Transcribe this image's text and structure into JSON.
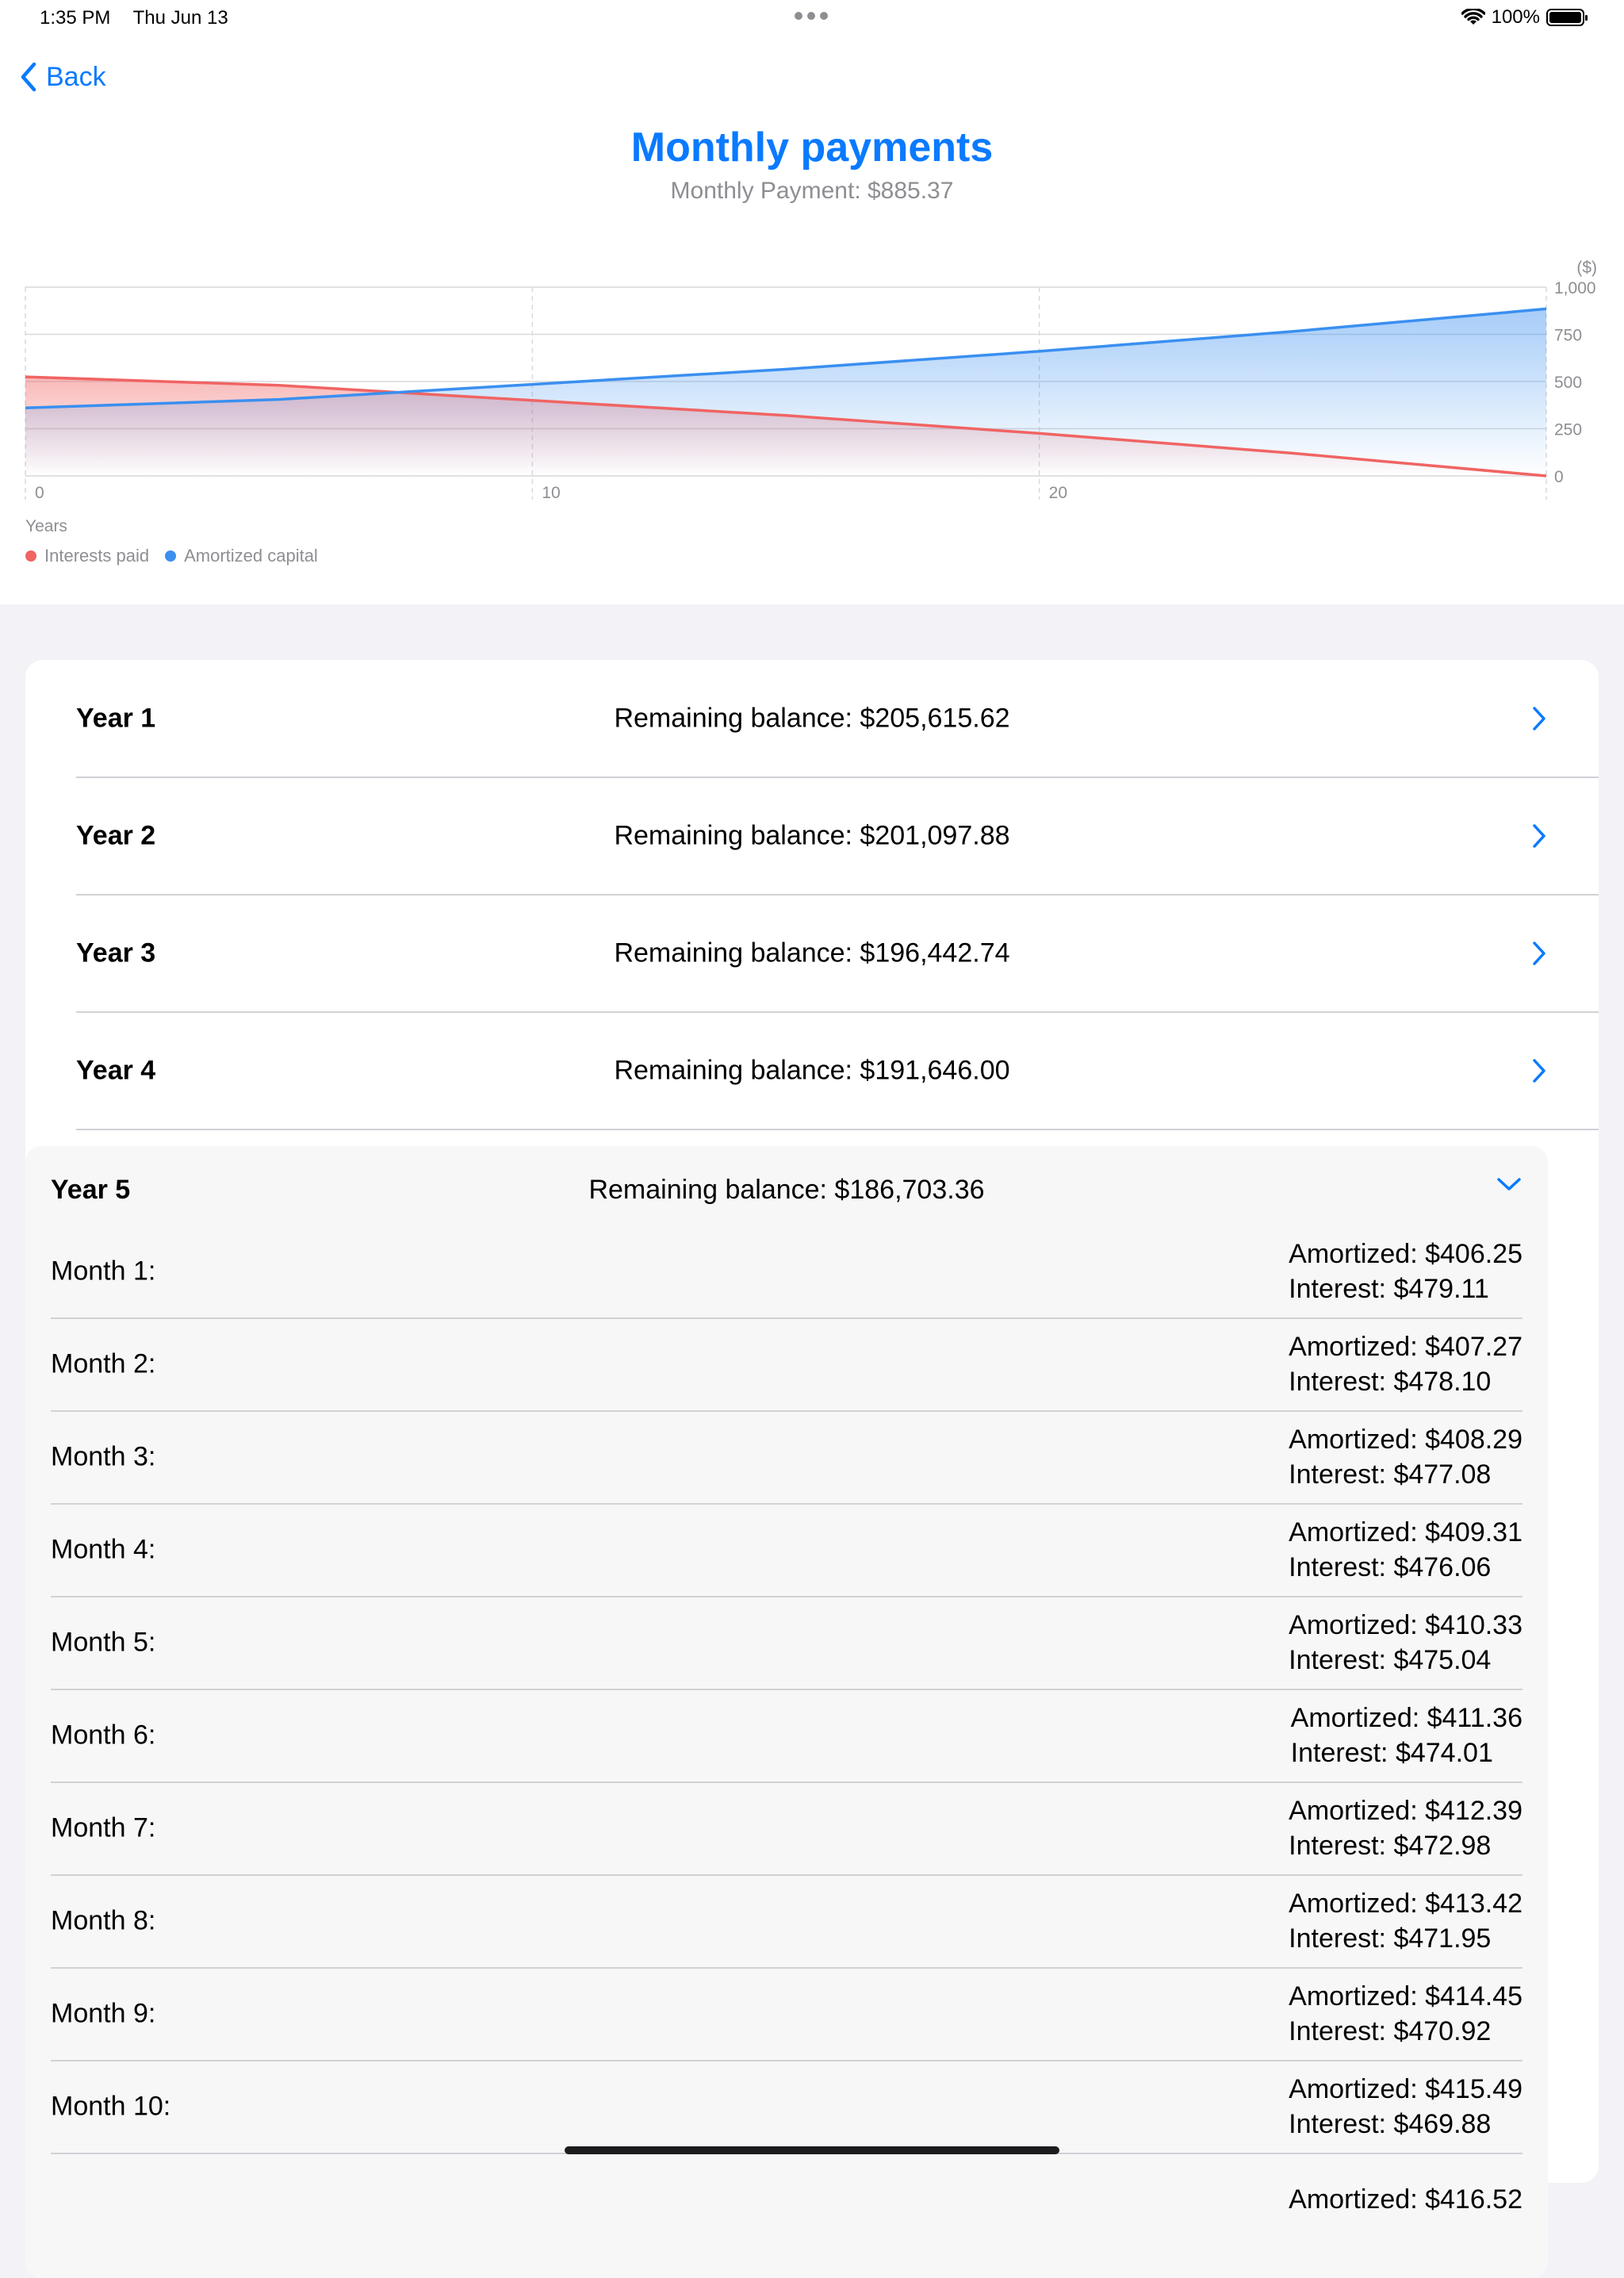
{
  "status_bar": {
    "time": "1:35 PM",
    "date": "Thu Jun 13",
    "battery": "100%"
  },
  "nav": {
    "back_label": "Back"
  },
  "header": {
    "title": "Monthly payments",
    "subtitle": "Monthly Payment: $885.37"
  },
  "chart_data": {
    "type": "area",
    "xlabel": "Years",
    "ylabel": "($)",
    "xlim": [
      0,
      30
    ],
    "ylim": [
      0,
      1000
    ],
    "x_ticks": [
      "0",
      "10",
      "20"
    ],
    "y_ticks": [
      "1,000",
      "750",
      "500",
      "250",
      "0"
    ],
    "grid": true,
    "legend_position": "bottom-left",
    "series": [
      {
        "name": "Interests paid",
        "color": "#f06463",
        "x": [
          0,
          5,
          10,
          15,
          20,
          25,
          30
        ],
        "values": [
          525,
          480,
          400,
          320,
          225,
          120,
          0
        ]
      },
      {
        "name": "Amortized capital",
        "color": "#3a8ff0",
        "x": [
          0,
          5,
          10,
          15,
          20,
          25,
          30
        ],
        "values": [
          360,
          405,
          485,
          565,
          660,
          765,
          885
        ]
      }
    ]
  },
  "years": [
    {
      "label": "Year 1",
      "balance": "Remaining balance: $205,615.62"
    },
    {
      "label": "Year 2",
      "balance": "Remaining balance: $201,097.88"
    },
    {
      "label": "Year 3",
      "balance": "Remaining balance: $196,442.74"
    },
    {
      "label": "Year 4",
      "balance": "Remaining balance: $191,646.00"
    }
  ],
  "expanded_year": {
    "label": "Year 5",
    "balance": "Remaining balance: $186,703.36",
    "months": [
      {
        "label": "Month 1:",
        "amortized": "Amortized: $406.25",
        "interest": "Interest: $479.11"
      },
      {
        "label": "Month 2:",
        "amortized": "Amortized: $407.27",
        "interest": "Interest: $478.10"
      },
      {
        "label": "Month 3:",
        "amortized": "Amortized: $408.29",
        "interest": "Interest: $477.08"
      },
      {
        "label": "Month 4:",
        "amortized": "Amortized: $409.31",
        "interest": "Interest: $476.06"
      },
      {
        "label": "Month 5:",
        "amortized": "Amortized: $410.33",
        "interest": "Interest: $475.04"
      },
      {
        "label": "Month 6:",
        "amortized": "Amortized: $411.36",
        "interest": "Interest: $474.01"
      },
      {
        "label": "Month 7:",
        "amortized": "Amortized: $412.39",
        "interest": "Interest: $472.98"
      },
      {
        "label": "Month 8:",
        "amortized": "Amortized: $413.42",
        "interest": "Interest: $471.95"
      },
      {
        "label": "Month 9:",
        "amortized": "Amortized: $414.45",
        "interest": "Interest: $470.92"
      },
      {
        "label": "Month 10:",
        "amortized": "Amortized: $415.49",
        "interest": "Interest: $469.88"
      },
      {
        "label": "",
        "amortized": "Amortized: $416.52",
        "interest": ""
      }
    ]
  },
  "colors": {
    "accent": "#0a7aff",
    "interest": "#f06463",
    "capital": "#3a8ff0"
  }
}
